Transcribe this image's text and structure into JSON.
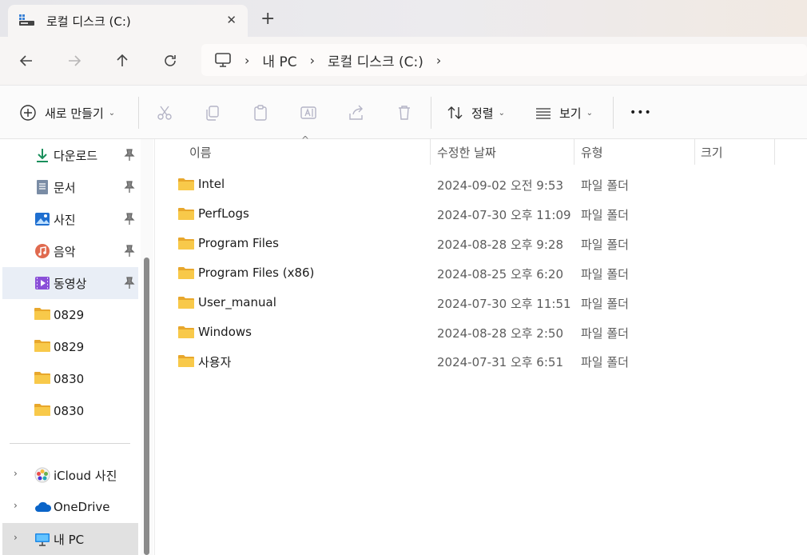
{
  "tab": {
    "title": "로컬 디스크 (C:)",
    "close": "✕",
    "new_tab": "+"
  },
  "address": {
    "crumbs": [
      "내 PC",
      "로컬 디스크 (C:)"
    ]
  },
  "toolbar": {
    "new_label": "새로 만들기",
    "sort_label": "정렬",
    "view_label": "보기",
    "more_label": "•••"
  },
  "sidebar": {
    "quick": [
      {
        "label": "다운로드",
        "icon": "download-icon"
      },
      {
        "label": "문서",
        "icon": "document-icon"
      },
      {
        "label": "사진",
        "icon": "pictures-icon"
      },
      {
        "label": "음악",
        "icon": "music-icon"
      },
      {
        "label": "동영상",
        "icon": "video-icon"
      },
      {
        "label": "0829",
        "icon": "folder-icon"
      },
      {
        "label": "0829",
        "icon": "folder-icon"
      },
      {
        "label": "0830",
        "icon": "folder-icon"
      },
      {
        "label": "0830",
        "icon": "folder-icon"
      }
    ],
    "roots": [
      {
        "label": "iCloud 사진",
        "icon": "icloud-photos-icon"
      },
      {
        "label": "OneDrive",
        "icon": "onedrive-icon"
      },
      {
        "label": "내 PC",
        "icon": "pc-icon"
      }
    ]
  },
  "columns": {
    "name": "이름",
    "modified": "수정한 날짜",
    "type": "유형",
    "size": "크기"
  },
  "files": [
    {
      "name": "Intel",
      "modified": "2024-09-02 오전 9:53",
      "type": "파일 폴더"
    },
    {
      "name": "PerfLogs",
      "modified": "2024-07-30 오후 11:09",
      "type": "파일 폴더"
    },
    {
      "name": "Program Files",
      "modified": "2024-08-28 오후 9:28",
      "type": "파일 폴더"
    },
    {
      "name": "Program Files (x86)",
      "modified": "2024-08-25 오후 6:20",
      "type": "파일 폴더"
    },
    {
      "name": "User_manual",
      "modified": "2024-07-30 오후 11:51",
      "type": "파일 폴더"
    },
    {
      "name": "Windows",
      "modified": "2024-08-28 오후 2:50",
      "type": "파일 폴더"
    },
    {
      "name": "사용자",
      "modified": "2024-07-31 오후 6:51",
      "type": "파일 폴더"
    }
  ],
  "colors": {
    "folder": "#f5c342",
    "selection": "#e9eef6",
    "accent": "#0067c0"
  }
}
